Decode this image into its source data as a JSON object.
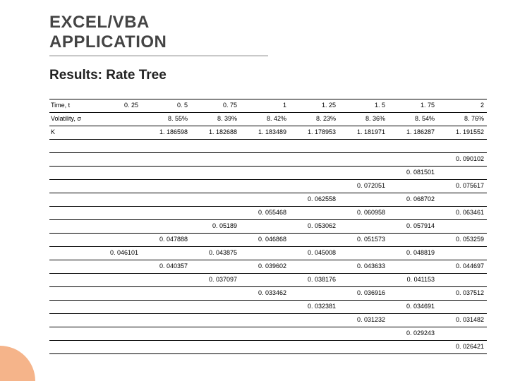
{
  "title": "EXCEL/VBA APPLICATION",
  "subtitle": "Results: Rate Tree",
  "header_rows": [
    {
      "label": "Time, t",
      "cells": [
        "0. 25",
        "0. 5",
        "0. 75",
        "1",
        "1. 25",
        "1. 5",
        "1. 75",
        "2"
      ]
    },
    {
      "label": "Volatility, σ",
      "cells": [
        "",
        "8. 55%",
        "8. 39%",
        "8. 42%",
        "8. 23%",
        "8. 36%",
        "8. 54%",
        "8. 76%"
      ]
    },
    {
      "label": "K",
      "cells": [
        "",
        "1. 186598",
        "1. 182688",
        "1. 183489",
        "1. 178953",
        "1. 181971",
        "1. 186287",
        "1. 191552"
      ]
    }
  ],
  "tree_rows": [
    [
      "",
      "",
      "",
      "",
      "",
      "",
      "",
      "",
      "0. 090102"
    ],
    [
      "",
      "",
      "",
      "",
      "",
      "",
      "",
      "0. 081501",
      ""
    ],
    [
      "",
      "",
      "",
      "",
      "",
      "",
      "0. 072051",
      "",
      "0. 075617"
    ],
    [
      "",
      "",
      "",
      "",
      "",
      "0. 062558",
      "",
      "0. 068702",
      ""
    ],
    [
      "",
      "",
      "",
      "",
      "0. 055468",
      "",
      "0. 060958",
      "",
      "0. 063461"
    ],
    [
      "",
      "",
      "",
      "0. 05189",
      "",
      "0. 053062",
      "",
      "0. 057914",
      ""
    ],
    [
      "",
      "",
      "0. 047888",
      "",
      "0. 046868",
      "",
      "0. 051573",
      "",
      "0. 053259"
    ],
    [
      "",
      "0. 046101",
      "",
      "0. 043875",
      "",
      "0. 045008",
      "",
      "0. 048819",
      ""
    ],
    [
      "",
      "",
      "0. 040357",
      "",
      "0. 039602",
      "",
      "0. 043633",
      "",
      "0. 044697"
    ],
    [
      "",
      "",
      "",
      "0. 037097",
      "",
      "0. 038176",
      "",
      "0. 041153",
      ""
    ],
    [
      "",
      "",
      "",
      "",
      "0. 033462",
      "",
      "0. 036916",
      "",
      "0. 037512"
    ],
    [
      "",
      "",
      "",
      "",
      "",
      "0. 032381",
      "",
      "0. 034691",
      ""
    ],
    [
      "",
      "",
      "",
      "",
      "",
      "",
      "0. 031232",
      "",
      "0. 031482"
    ],
    [
      "",
      "",
      "",
      "",
      "",
      "",
      "",
      "0. 029243",
      ""
    ],
    [
      "",
      "",
      "",
      "",
      "",
      "",
      "",
      "",
      "0. 026421"
    ]
  ]
}
